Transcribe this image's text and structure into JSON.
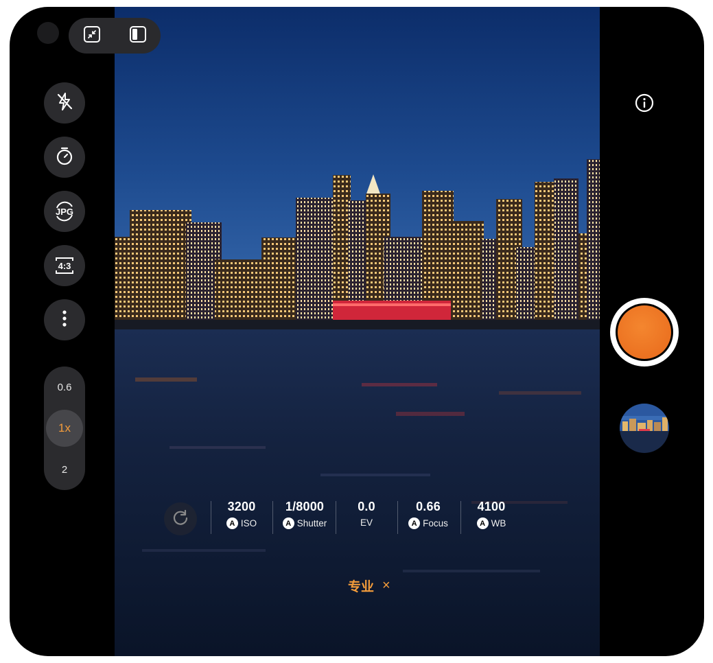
{
  "window_controls": [
    {
      "name": "collapse-icon"
    },
    {
      "name": "split-view-icon"
    }
  ],
  "left_toolbar": [
    {
      "name": "flash-off-icon"
    },
    {
      "name": "timer-icon"
    },
    {
      "name": "jpg-format-icon",
      "label": "JPG"
    },
    {
      "name": "aspect-ratio-icon",
      "label": "4:3"
    },
    {
      "name": "more-options-icon"
    }
  ],
  "zoom": {
    "options": [
      "0.6",
      "1x",
      "2"
    ],
    "selected": "1x"
  },
  "right_panel": {
    "info_icon": "info-icon",
    "shutter_color": "#ee7424"
  },
  "pro_controls": {
    "reset_icon": "reset-icon",
    "params": [
      {
        "value": "3200",
        "label": "ISO",
        "auto": true,
        "auto_label": "A"
      },
      {
        "value": "1/8000",
        "label": "Shutter",
        "auto": true,
        "auto_label": "A"
      },
      {
        "value": "0.0",
        "label": "EV",
        "auto": false
      },
      {
        "value": "0.66",
        "label": "Focus",
        "auto": true,
        "auto_label": "A"
      },
      {
        "value": "4100",
        "label": "WB",
        "auto": true,
        "auto_label": "A"
      }
    ]
  },
  "mode": {
    "label": "专业",
    "close": "×"
  },
  "colors": {
    "accent": "#f39c3b",
    "button_bg": "#2b2b2e"
  }
}
